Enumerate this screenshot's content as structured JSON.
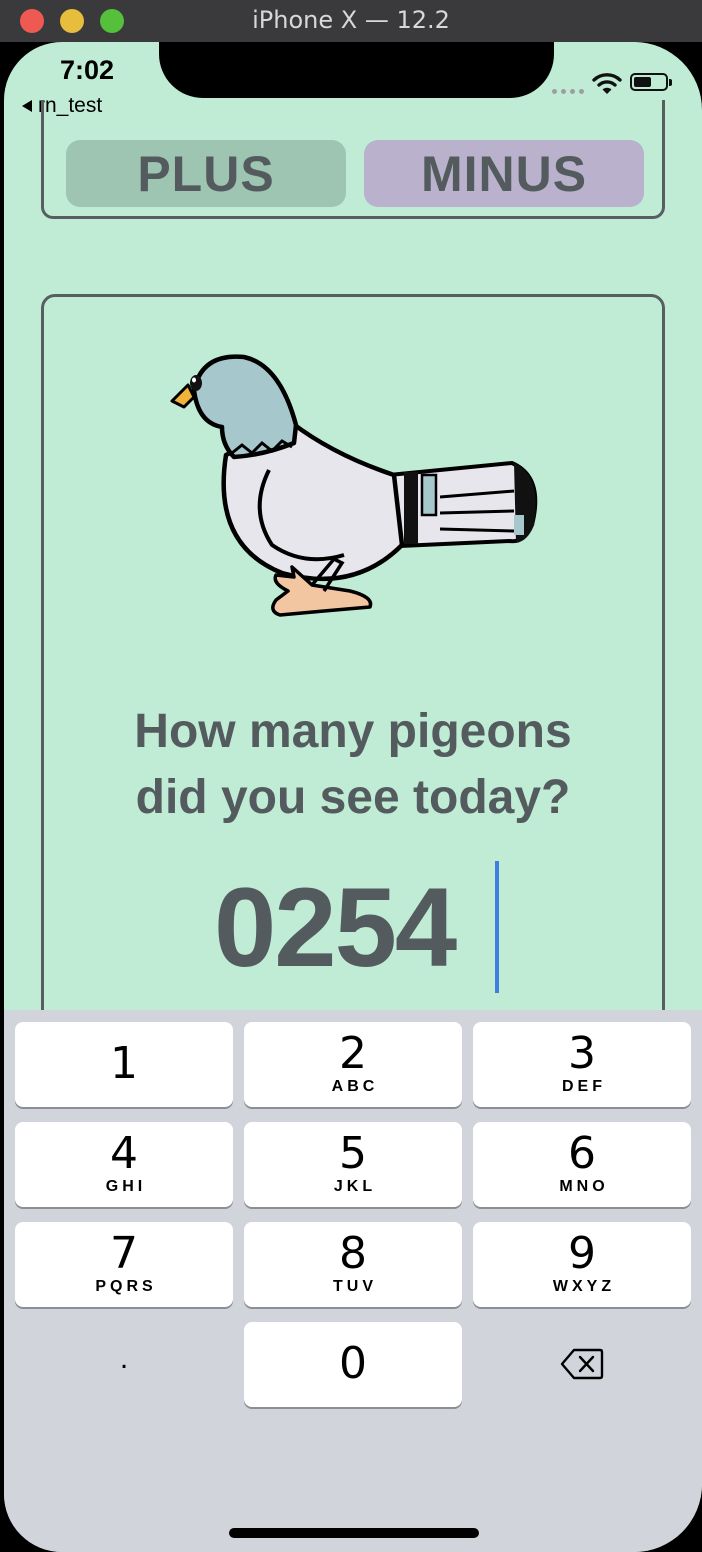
{
  "window": {
    "title": "iPhone X — 12.2"
  },
  "status_bar": {
    "time": "7:02",
    "back_label": "rn_test"
  },
  "controls": {
    "plus_label": "PLUS",
    "minus_label": "MINUS"
  },
  "card": {
    "question_line1": "How many pigeons",
    "question_line2": "did you see today?",
    "count": "0254"
  },
  "keypad": {
    "keys": [
      {
        "num": "1",
        "letters": ""
      },
      {
        "num": "2",
        "letters": "ABC"
      },
      {
        "num": "3",
        "letters": "DEF"
      },
      {
        "num": "4",
        "letters": "GHI"
      },
      {
        "num": "5",
        "letters": "JKL"
      },
      {
        "num": "6",
        "letters": "MNO"
      },
      {
        "num": "7",
        "letters": "PQRS"
      },
      {
        "num": "8",
        "letters": "TUV"
      },
      {
        "num": "9",
        "letters": "WXYZ"
      }
    ],
    "dot": ".",
    "zero": "0",
    "delete_icon": "delete-backspace-icon"
  },
  "colors": {
    "screen_bg": "#c0ecd6",
    "plus_bg": "#9ec5b1",
    "minus_bg": "#bab2cc",
    "text": "#545b5f",
    "cursor": "#3d7ee0",
    "keyboard_bg": "#d1d4da"
  }
}
